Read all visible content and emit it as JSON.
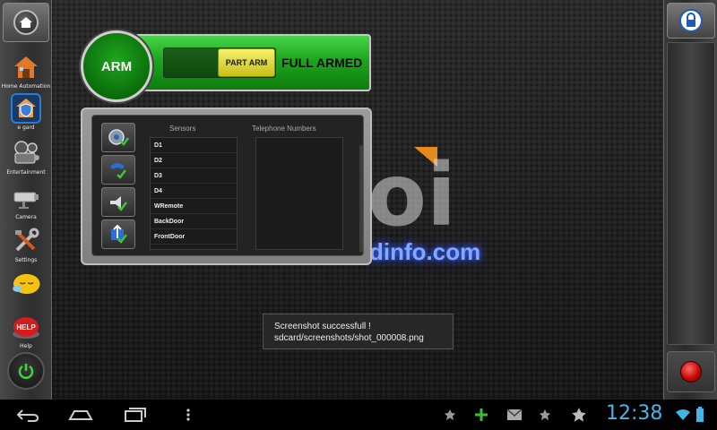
{
  "left_nav": {
    "items": [
      {
        "label": "Home Automation",
        "icon": "house-icon"
      },
      {
        "label": "e gard",
        "icon": "shield-house-icon"
      },
      {
        "label": "Entertainment",
        "icon": "projector-icon"
      },
      {
        "label": "Camera",
        "icon": "camera-icon"
      },
      {
        "label": "Settings",
        "icon": "tools-icon"
      },
      {
        "label": "",
        "icon": "sleep-face-icon"
      },
      {
        "label": "Help",
        "icon": "help-button-icon"
      }
    ]
  },
  "arm_panel": {
    "arm_label": "ARM",
    "slider_label": "PART ARM",
    "status": "FULL ARMED"
  },
  "sensors": {
    "heading": "Sensors",
    "items": [
      "D1",
      "D2",
      "D3",
      "D4",
      "WRemote",
      "BackDoor",
      "FrontDoor"
    ]
  },
  "telephone": {
    "heading": "Telephone Numbers",
    "items": []
  },
  "watermark": {
    "big": "oi",
    "domain": "dinfo.com"
  },
  "toast": {
    "line1": "Screenshot successfull !",
    "line2": "sdcard/screenshots/shot_000008.png"
  },
  "status_bar": {
    "time": "12:38"
  },
  "colors": {
    "arm_green": "#1fa51f",
    "slider_yellow": "#e6e030",
    "clock_blue": "#45b5e8",
    "record_red": "#d40000"
  }
}
